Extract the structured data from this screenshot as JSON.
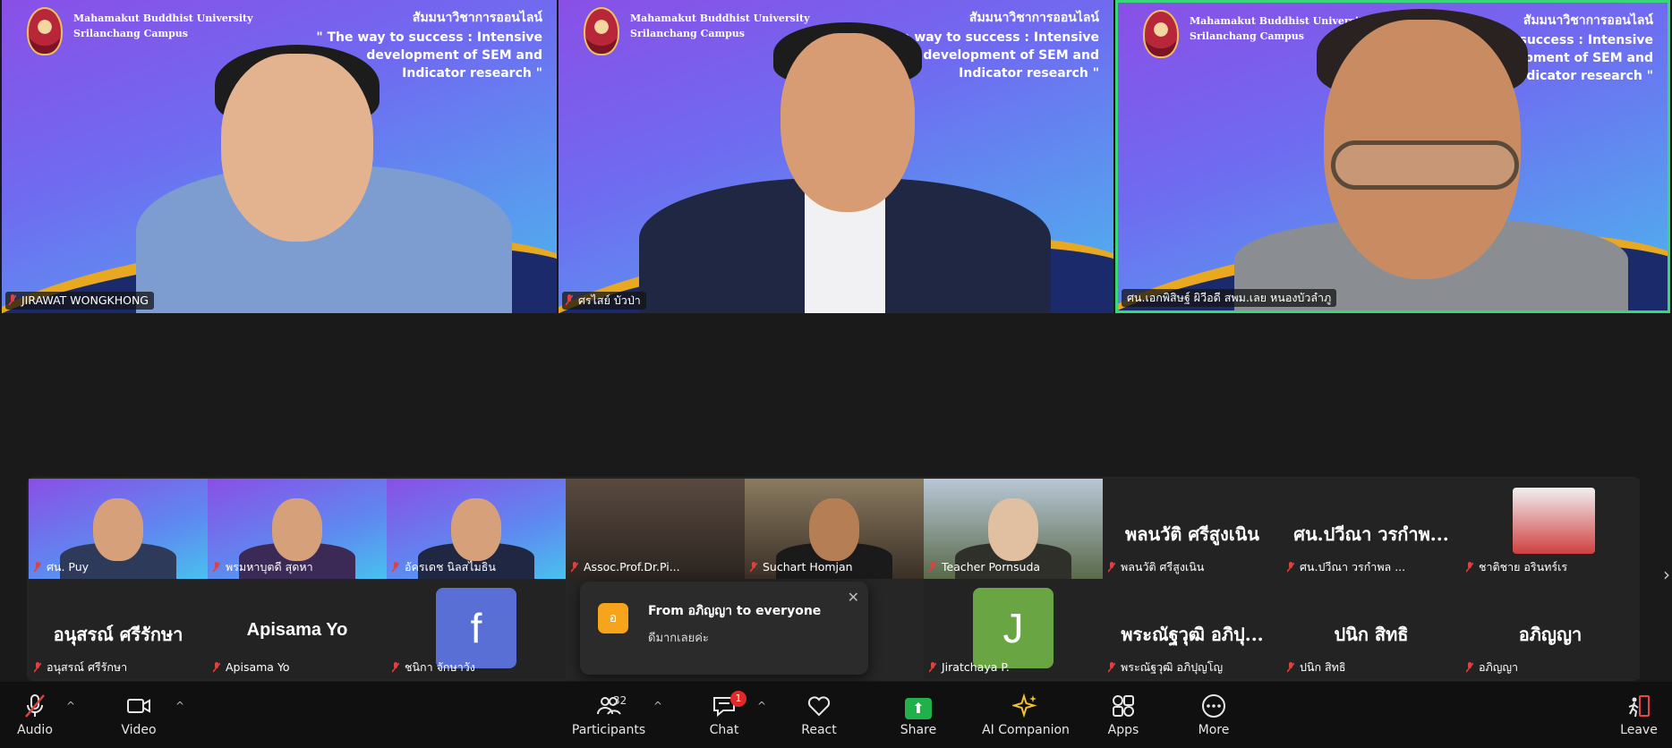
{
  "speakers": [
    {
      "name": "JIRAWAT WONGKHONG"
    },
    {
      "name": "ศรไสย์ บัวป่า"
    },
    {
      "name": "ศน.เอกพิสิษฐ์ ผิวีอดี สพม.เลย หนองบัวลำภู"
    }
  ],
  "banner": {
    "university_line1": "Mahamakut Buddhist University",
    "university_line2": "Srilanchang Campus",
    "seminar_th": "สัมมนาวิชาการออนไลน์",
    "topic_line1": "\" The way to success : Intensive",
    "topic_line2": "development of SEM and",
    "topic_line3": "Indicator research \""
  },
  "gallery": [
    {
      "name": "ศน. Puy"
    },
    {
      "name": "พรมหาบุตดี สุดหา"
    },
    {
      "name": "อัครเดช นิลสไมธิน"
    },
    {
      "name": "Assoc.Prof.Dr.Pi..."
    },
    {
      "name": "Suchart Homjan"
    },
    {
      "name": "Teacher Pornsuda"
    },
    {
      "name": "พลนวัติ ศรีสูงเนิน",
      "big": "พลนวัติ ศรีสูงเนิน"
    },
    {
      "name": "ศน.ปวีณา วรกำพล ...",
      "big": "ศน.ปวีณา วรกำพ..."
    },
    {
      "name": "ชาติชาย อรินทร์เร"
    },
    {
      "name": "อนุสรณ์ ศรีรักษา",
      "big": "อนุสรณ์ ศรีรักษา"
    },
    {
      "name": "Apisama Yo",
      "big": "Apisama Yo"
    },
    {
      "name": "ชนิกา จักษาวัง",
      "avatar": "f"
    },
    {
      "name": "Jiratchaya P.",
      "avatar": "J"
    },
    {
      "name": "พระณัฐวุฒิ อภิปุญโญ",
      "big": "พระณัฐวุฒิ อภิปุ..."
    },
    {
      "name": "ปนิก สิทธิ",
      "big": "ปนิก สิทธิ"
    },
    {
      "name": "อภิญญา",
      "big": "อภิญญา"
    }
  ],
  "chat_toast": {
    "avatar_letter": "อ",
    "from": "From อภิญญา to everyone",
    "message": "ดีมากเลยค่ะ"
  },
  "toolbar": {
    "audio": "Audio",
    "video": "Video",
    "participants": "Participants",
    "participants_count": "32",
    "chat": "Chat",
    "chat_badge": "1",
    "react": "React",
    "share": "Share",
    "ai_companion": "AI Companion",
    "apps": "Apps",
    "more": "More",
    "leave": "Leave"
  },
  "colors": {
    "active_speaker_border": "#3bd67a",
    "share_green": "#20b14a",
    "badge_red": "#e02a2a",
    "toast_avatar": "#f6a41c"
  }
}
